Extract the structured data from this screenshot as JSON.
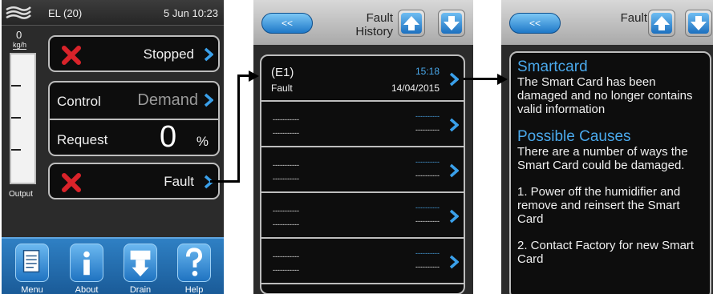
{
  "screen1": {
    "unit_name": "EL (20)",
    "datetime": "5 Jun 10:23",
    "gauge": {
      "value": "0",
      "unit": "kg/h",
      "label": "Output"
    },
    "status_label": "Stopped",
    "control_label": "Control",
    "control_value": "Demand",
    "request_label": "Request",
    "request_value": "0",
    "request_unit": "%",
    "fault_label": "Fault",
    "toolbar": [
      {
        "label": "Menu",
        "icon": "document-icon"
      },
      {
        "label": "About",
        "icon": "info-icon"
      },
      {
        "label": "Drain",
        "icon": "drain-icon"
      },
      {
        "label": "Help",
        "icon": "question-icon"
      }
    ],
    "colors": {
      "bar": "#1f6db5",
      "fault_x": "#d9232a"
    }
  },
  "screen2": {
    "back_label": "<<",
    "title_line1": "Fault",
    "title_line2": "History",
    "entries": [
      {
        "code": "(E1)",
        "type": "Fault",
        "time": "15:18",
        "date": "14/04/2015"
      },
      {
        "code": "-----------",
        "type": "-----------",
        "time": "----------",
        "date": "----------"
      },
      {
        "code": "-----------",
        "type": "-----------",
        "time": "----------",
        "date": "----------"
      },
      {
        "code": "-----------",
        "type": "-----------",
        "time": "----------",
        "date": "----------"
      },
      {
        "code": "-----------",
        "type": "-----------",
        "time": "----------",
        "date": "----------"
      }
    ]
  },
  "screen3": {
    "back_label": "<<",
    "title": "Fault",
    "heading1": "Smartcard",
    "body1": "The Smart Card has been damaged and no longer contains valid information",
    "heading2": "Possible Causes",
    "body2": "There are a number of ways the Smart Card could be damaged.",
    "body3": "1. Power off the humidifier and remove      and reinsert the Smart Card",
    "body4": "2. Contact Factory for new Smart Card"
  }
}
